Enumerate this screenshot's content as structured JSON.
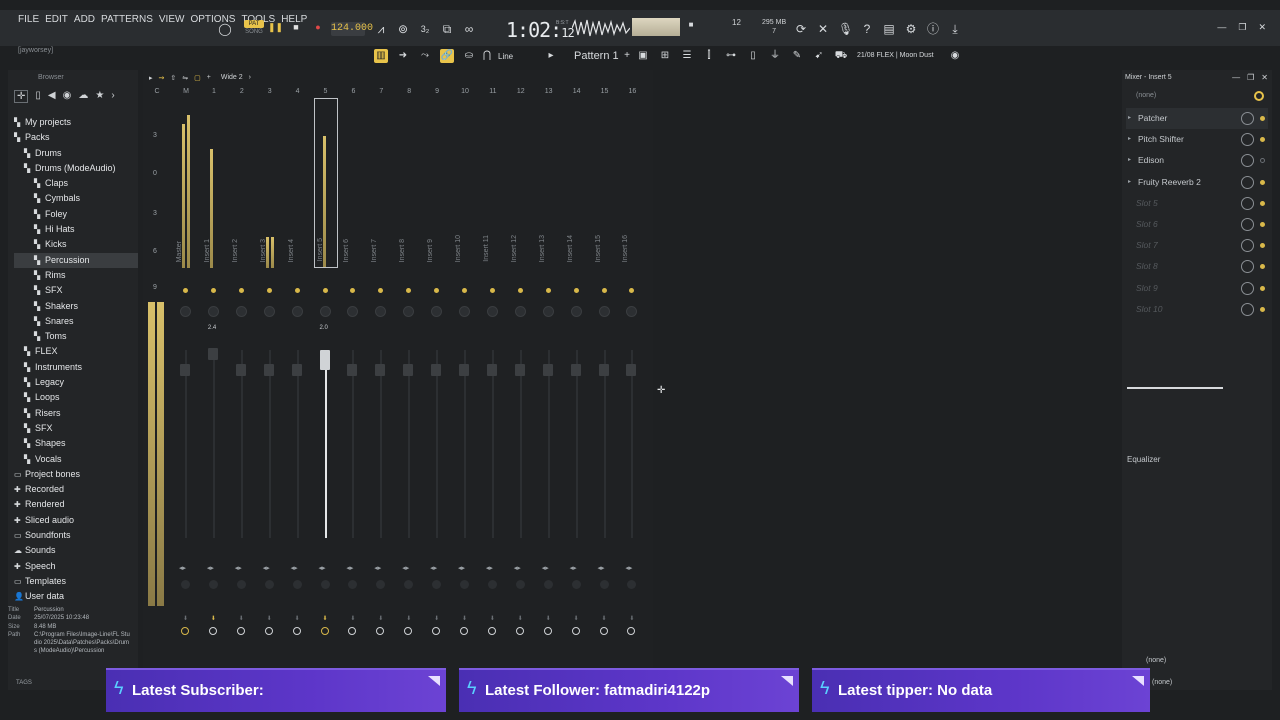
{
  "app": {
    "menu": [
      "FILE",
      "EDIT",
      "ADD",
      "PATTERNS",
      "VIEW",
      "OPTIONS",
      "TOOLS",
      "HELP"
    ],
    "user_hint": "[jayworsey]",
    "pat_label": "PAT",
    "song_label": "SONG",
    "tempo": "124.000",
    "clock_main": "1:02:",
    "clock_sub": "12",
    "clock_unit": "B:S:T",
    "poly": "12",
    "mem_top": "295 MB",
    "mem_bottom": "7",
    "pattern": "Pattern 1",
    "snap": "Line",
    "hint_panel": "21/08  FLEX | Moon Dust"
  },
  "browser": {
    "title": "Browser",
    "tree": [
      {
        "label": "My projects",
        "level": 0,
        "icon": "folder-icon"
      },
      {
        "label": "Packs",
        "level": 0,
        "icon": "folder-icon"
      },
      {
        "label": "Drums",
        "level": 1,
        "icon": "folder-icon"
      },
      {
        "label": "Drums (ModeAudio)",
        "level": 1,
        "icon": "folder-icon"
      },
      {
        "label": "Claps",
        "level": 2,
        "icon": "folder-icon"
      },
      {
        "label": "Cymbals",
        "level": 2,
        "icon": "folder-icon"
      },
      {
        "label": "Foley",
        "level": 2,
        "icon": "folder-icon"
      },
      {
        "label": "Hi Hats",
        "level": 2,
        "icon": "folder-icon"
      },
      {
        "label": "Kicks",
        "level": 2,
        "icon": "folder-icon"
      },
      {
        "label": "Percussion",
        "level": 2,
        "icon": "folder-icon",
        "selected": true
      },
      {
        "label": "Rims",
        "level": 2,
        "icon": "folder-icon"
      },
      {
        "label": "SFX",
        "level": 2,
        "icon": "folder-icon"
      },
      {
        "label": "Shakers",
        "level": 2,
        "icon": "folder-icon"
      },
      {
        "label": "Snares",
        "level": 2,
        "icon": "folder-icon"
      },
      {
        "label": "Toms",
        "level": 2,
        "icon": "folder-icon"
      },
      {
        "label": "FLEX",
        "level": 1,
        "icon": "folder-icon"
      },
      {
        "label": "Instruments",
        "level": 1,
        "icon": "folder-icon"
      },
      {
        "label": "Legacy",
        "level": 1,
        "icon": "folder-icon"
      },
      {
        "label": "Loops",
        "level": 1,
        "icon": "folder-icon"
      },
      {
        "label": "Risers",
        "level": 1,
        "icon": "folder-icon"
      },
      {
        "label": "SFX",
        "level": 1,
        "icon": "folder-icon"
      },
      {
        "label": "Shapes",
        "level": 1,
        "icon": "folder-icon"
      },
      {
        "label": "Vocals",
        "level": 1,
        "icon": "folder-icon"
      },
      {
        "label": "Project bones",
        "level": 0,
        "icon": "folder-outline-icon"
      },
      {
        "label": "Recorded",
        "level": 0,
        "icon": "plus-icon"
      },
      {
        "label": "Rendered",
        "level": 0,
        "icon": "plus-icon"
      },
      {
        "label": "Sliced audio",
        "level": 0,
        "icon": "plus-icon"
      },
      {
        "label": "Soundfonts",
        "level": 0,
        "icon": "folder-outline-icon"
      },
      {
        "label": "Sounds",
        "level": 0,
        "icon": "cloud-icon"
      },
      {
        "label": "Speech",
        "level": 0,
        "icon": "plus-icon"
      },
      {
        "label": "Templates",
        "level": 0,
        "icon": "folder-outline-icon"
      },
      {
        "label": "User data",
        "level": 0,
        "icon": "user-icon"
      }
    ],
    "info": {
      "title_k": "Title",
      "title_v": "Percussion",
      "date_k": "Date",
      "date_v": "25/07/2025 10:23:48",
      "size_k": "Size",
      "size_v": "8.48 MB",
      "path_k": "Path",
      "path_v": "C:\\Program Files\\Image-Line\\FL Studio 2025\\Data\\Patches\\Packs\\Drums (ModeAudio)\\Percussion"
    },
    "tags": "TAGS"
  },
  "mixer": {
    "header": "Wide 2",
    "col_letters": [
      "C",
      "M"
    ],
    "channels": [
      "Master",
      "Insert 1",
      "Insert 2",
      "Insert 3",
      "Insert 4",
      "Insert 5",
      "Insert 6",
      "Insert 7",
      "Insert 8",
      "Insert 9",
      "Insert 10",
      "Insert 11",
      "Insert 12",
      "Insert 13",
      "Insert 14",
      "Insert 15",
      "Insert 16"
    ],
    "numbers": [
      "1",
      "2",
      "3",
      "4",
      "5",
      "6",
      "7",
      "8",
      "9",
      "10",
      "11",
      "12",
      "13",
      "14",
      "15",
      "16"
    ],
    "db_marks": [
      "3",
      "0",
      "3",
      "6",
      "9"
    ],
    "fader_vals": {
      "insert1": "2.4",
      "insert5": "2.0"
    },
    "active_channel_index": 5
  },
  "insert": {
    "title": "Mixer - Insert 5",
    "input": "(none)",
    "slots": [
      {
        "label": "Patcher",
        "empty": false,
        "on": true
      },
      {
        "label": "Pitch Shifter",
        "empty": false,
        "on": true
      },
      {
        "label": "Edison",
        "empty": false,
        "on": false
      },
      {
        "label": "Fruity Reeverb 2",
        "empty": false,
        "on": true
      },
      {
        "label": "Slot 5",
        "empty": true,
        "on": true
      },
      {
        "label": "Slot 6",
        "empty": true,
        "on": true
      },
      {
        "label": "Slot 7",
        "empty": true,
        "on": true
      },
      {
        "label": "Slot 8",
        "empty": true,
        "on": true
      },
      {
        "label": "Slot 9",
        "empty": true,
        "on": true
      },
      {
        "label": "Slot 10",
        "empty": true,
        "on": true
      }
    ],
    "eq_label": "Equalizer",
    "output1": "(none)",
    "output2": "(none)"
  },
  "overlay": {
    "subscriber": "Latest Subscriber:",
    "follower": "Latest Follower: fatmadiri4122p",
    "tipper": "Latest tipper: No data"
  },
  "colors": {
    "accent": "#e8c34a",
    "banner": "#5d36c9",
    "bolt": "#5ad0ff"
  }
}
